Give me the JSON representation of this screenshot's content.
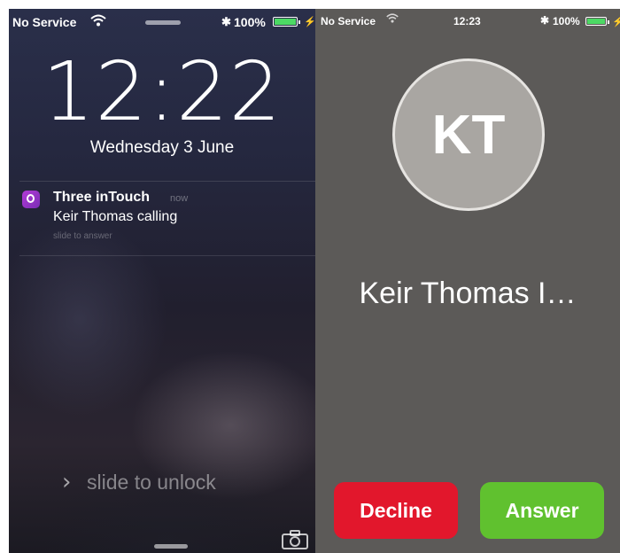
{
  "lock_screen": {
    "status": {
      "carrier": "No Service",
      "bluetooth": "✱",
      "battery_pct": "100%",
      "battery_level": 1.0
    },
    "time": "12:22",
    "date": "Wednesday 3 June",
    "notification": {
      "app": "Three inTouch",
      "time": "now",
      "message": "Keir Thomas calling",
      "hint": "slide to answer"
    },
    "slider": {
      "chevron": "›",
      "label": "slide to unlock"
    }
  },
  "incoming_call": {
    "status": {
      "carrier": "No Service",
      "time": "12:23",
      "bluetooth": "✱",
      "battery_pct": "100%",
      "battery_level": 1.0
    },
    "avatar_initials": "KT",
    "caller_name": "Keir Thomas I…",
    "decline_label": "Decline",
    "answer_label": "Answer"
  },
  "colors": {
    "decline": "#e2172c",
    "answer": "#60c12f",
    "battery": "#4cd964",
    "call_background": "#5c5a58"
  },
  "icons": [
    "wifi-icon",
    "bluetooth-icon",
    "battery-icon",
    "app-icon",
    "chevron-right-icon",
    "camera-icon"
  ]
}
